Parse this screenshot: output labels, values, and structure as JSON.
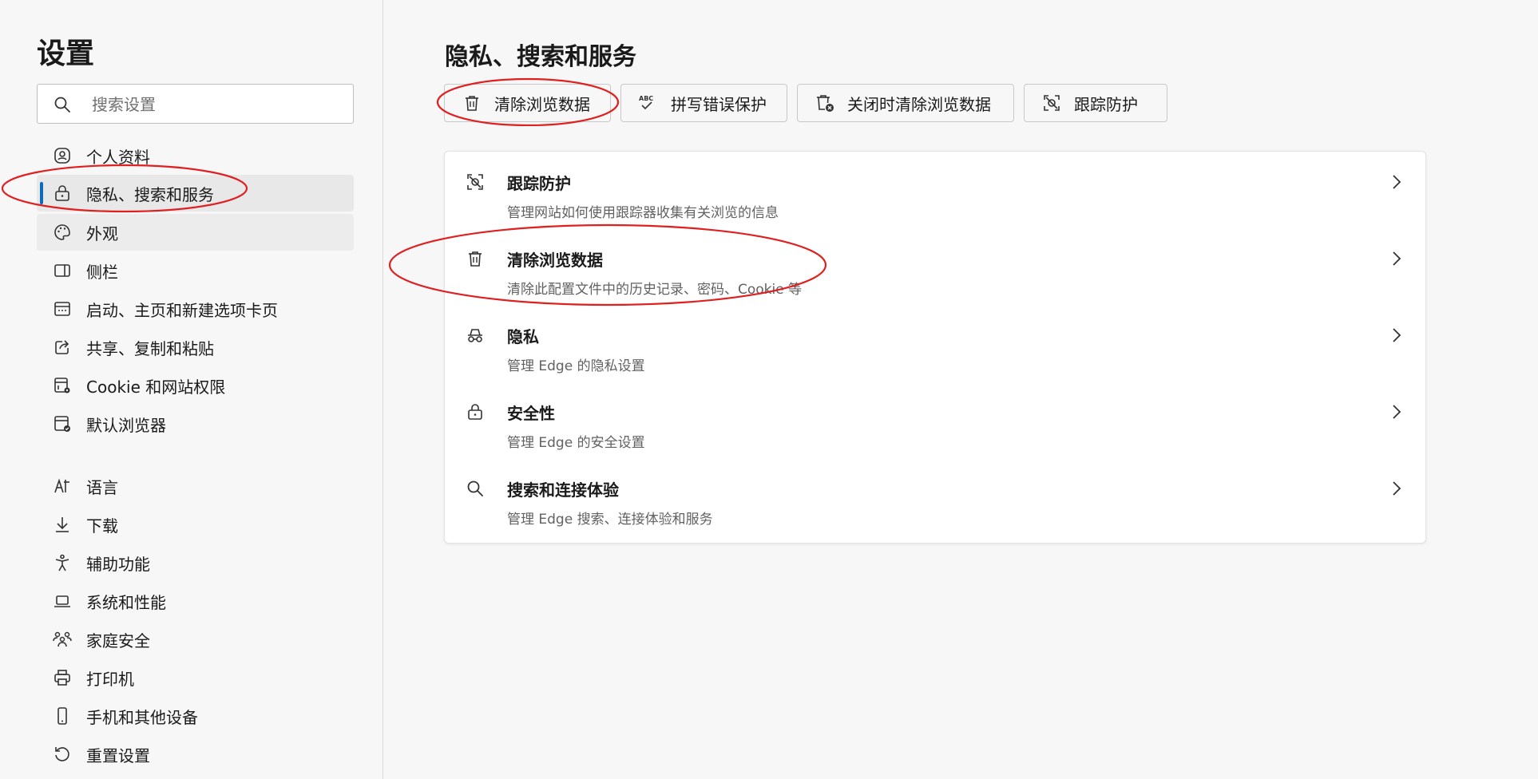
{
  "sidebar": {
    "title": "设置",
    "search_placeholder": "搜索设置",
    "items": [
      {
        "label": "个人资料",
        "icon": "profile-icon"
      },
      {
        "label": "隐私、搜索和服务",
        "icon": "lock-icon"
      },
      {
        "label": "外观",
        "icon": "palette-icon"
      },
      {
        "label": "侧栏",
        "icon": "sidebar-icon"
      },
      {
        "label": "启动、主页和新建选项卡页",
        "icon": "home-tabs-icon"
      },
      {
        "label": "共享、复制和粘贴",
        "icon": "share-icon"
      },
      {
        "label": "Cookie 和网站权限",
        "icon": "cookie-permissions-icon"
      },
      {
        "label": "默认浏览器",
        "icon": "default-browser-icon"
      },
      {
        "label": "语言",
        "icon": "language-icon"
      },
      {
        "label": "下载",
        "icon": "download-icon"
      },
      {
        "label": "辅助功能",
        "icon": "accessibility-icon"
      },
      {
        "label": "系统和性能",
        "icon": "laptop-icon"
      },
      {
        "label": "家庭安全",
        "icon": "family-icon"
      },
      {
        "label": "打印机",
        "icon": "printer-icon"
      },
      {
        "label": "手机和其他设备",
        "icon": "phone-icon"
      },
      {
        "label": "重置设置",
        "icon": "reset-icon"
      }
    ],
    "active_item": "隐私、搜索和服务"
  },
  "main": {
    "title": "隐私、搜索和服务",
    "toolbar": [
      {
        "label": "清除浏览数据",
        "icon": "trash-icon"
      },
      {
        "label": "拼写错误保护",
        "icon": "spellcheck-icon"
      },
      {
        "label": "关闭时清除浏览数据",
        "icon": "trash-clock-icon"
      },
      {
        "label": "跟踪防护",
        "icon": "tracking-icon"
      }
    ],
    "rows": [
      {
        "title": "跟踪防护",
        "desc": "管理网站如何使用跟踪器收集有关浏览的信息",
        "icon": "tracking-icon"
      },
      {
        "title": "清除浏览数据",
        "desc": "清除此配置文件中的历史记录、密码、Cookie 等",
        "icon": "trash-icon"
      },
      {
        "title": "隐私",
        "desc": "管理 Edge 的隐私设置",
        "icon": "incognito-icon"
      },
      {
        "title": "安全性",
        "desc": "管理 Edge 的安全设置",
        "icon": "lock-icon"
      },
      {
        "title": "搜索和连接体验",
        "desc": "管理 Edge 搜索、连接体验和服务",
        "icon": "search-icon"
      }
    ]
  },
  "colors": {
    "accent": "#0f6cbd",
    "annotation": "#e02020",
    "background": "#f7f7f7"
  }
}
